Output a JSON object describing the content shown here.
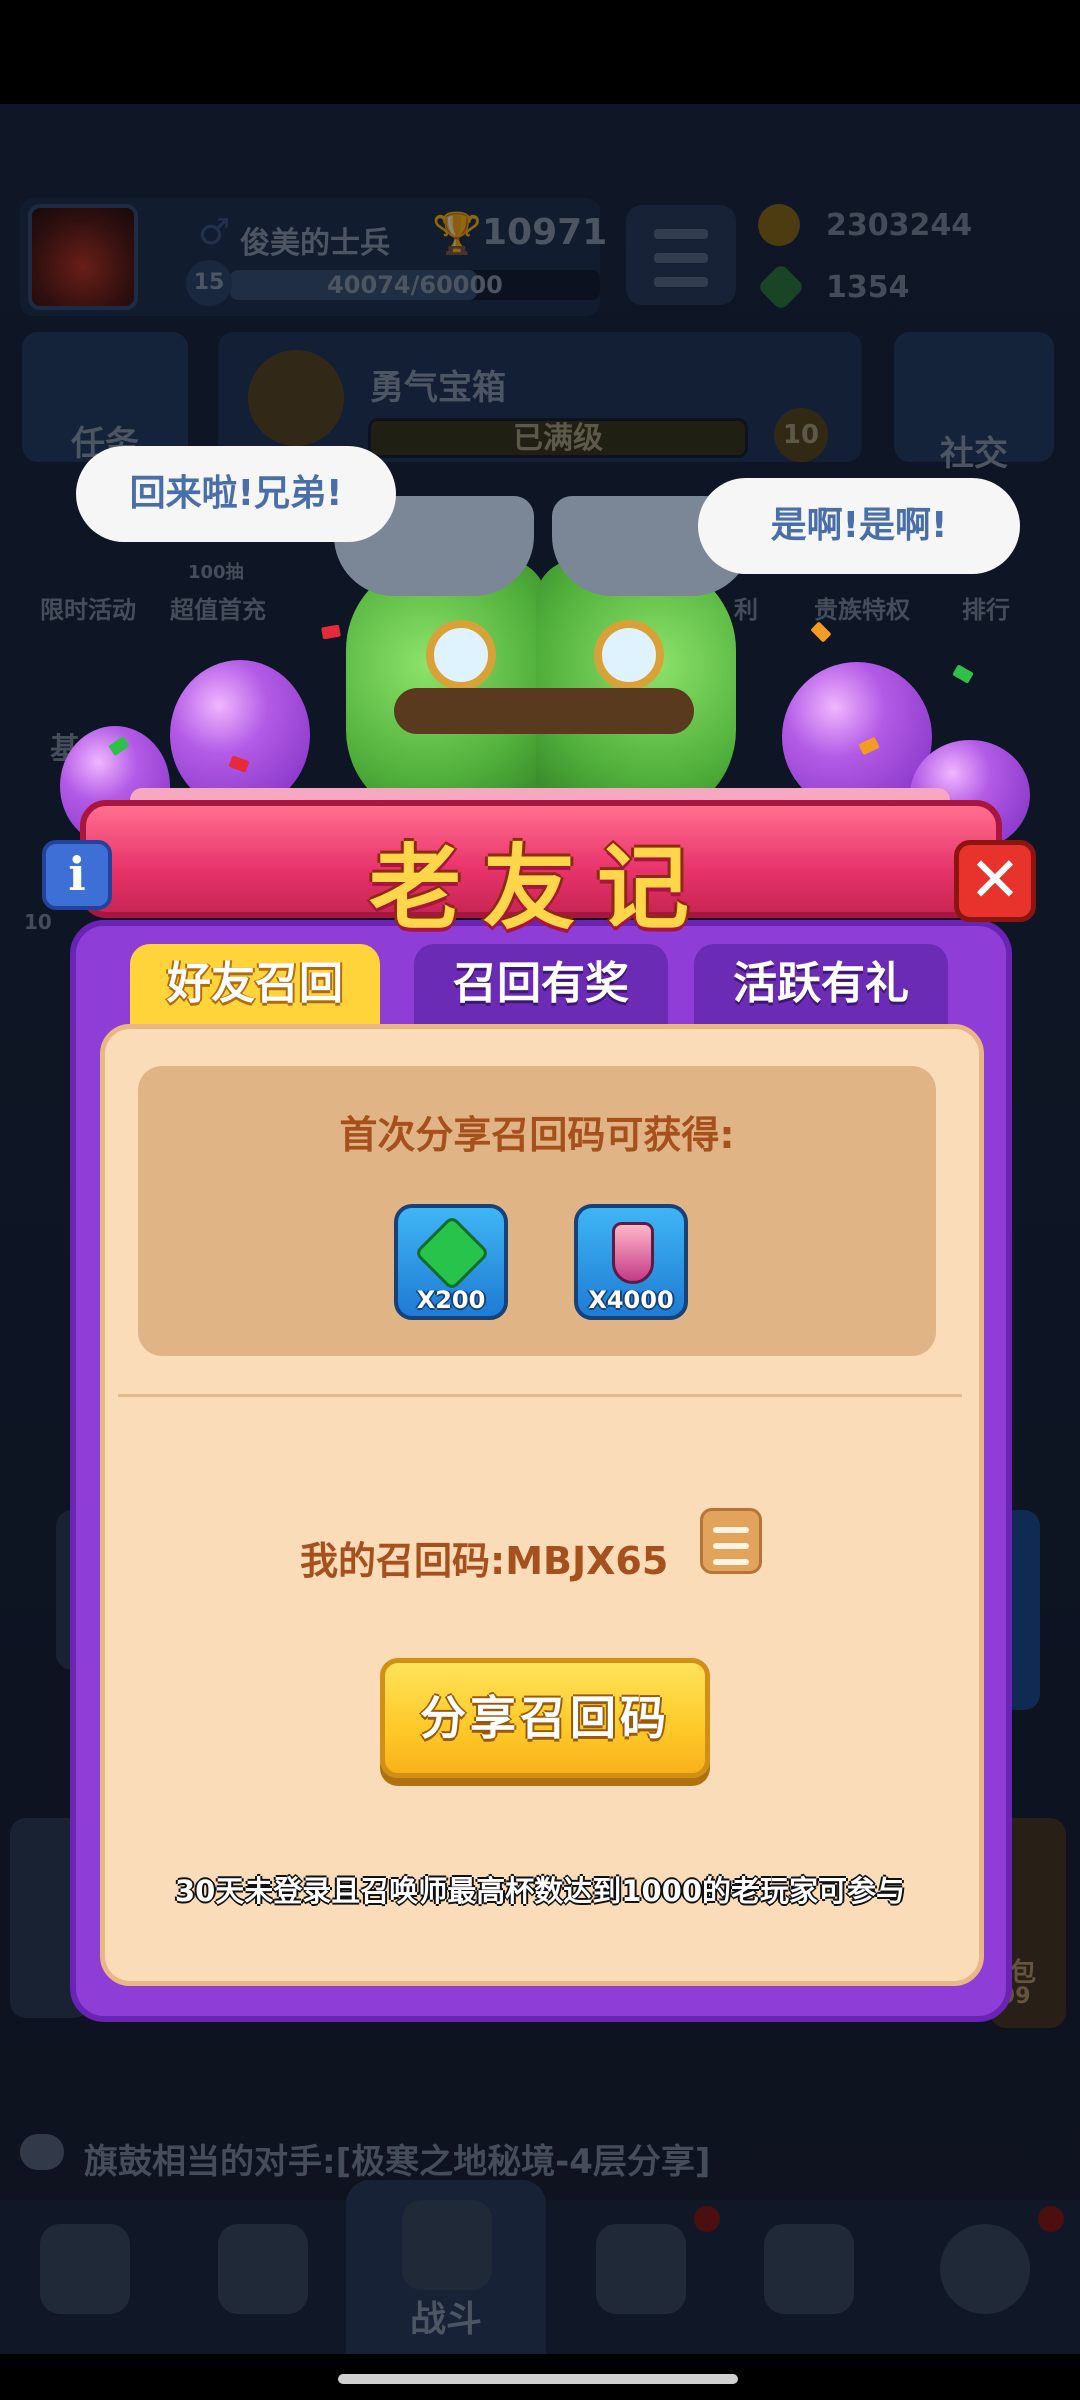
{
  "header": {
    "player_name": "俊美的士兵",
    "trophies": "10971",
    "level": "15",
    "xp": "40074/60000",
    "xp_progress": 0.668,
    "gold": "2303244",
    "gems": "1354"
  },
  "background": {
    "task_label": "任务",
    "chest_name": "勇气宝箱",
    "chest_status": "已满级",
    "chest_badge": "10",
    "social_label": "社交",
    "side_items": [
      "限时活动",
      "超值首充",
      "利",
      "贵族特权",
      "排行"
    ],
    "side_sub": [
      "100抽"
    ],
    "small_labels": [
      "基",
      "10",
      "包",
      "99"
    ]
  },
  "speech": {
    "left": "回来啦!兄弟!",
    "right": "是啊!是啊!"
  },
  "dialog": {
    "title": "老友记",
    "info_icon": "i",
    "close_icon": "✕",
    "tabs": [
      {
        "label": "好友召回",
        "active": true
      },
      {
        "label": "召回有奖",
        "active": false
      },
      {
        "label": "活跃有礼",
        "active": false
      }
    ],
    "reward_title": "首次分享召回码可获得:",
    "rewards": [
      {
        "icon": "gem-icon",
        "qty": "X200"
      },
      {
        "icon": "potion-icon",
        "qty": "X4000"
      }
    ],
    "code_label": "我的召回码:MBJX65",
    "share_button": "分享召回码",
    "note": "30天未登录且召唤师最高杯数达到1000的老玩家可参与"
  },
  "ticker": {
    "text": "旗鼓相当的对手:[极寒之地秘境-4层分享]"
  },
  "navbar": {
    "battle_label": "战斗"
  },
  "colors": {
    "dialog_frame": "#8e3ed6",
    "banner": "#e8336b",
    "title_text": "#ffd64a",
    "panel": "#fadcb8",
    "accent_text": "#a6511d",
    "share_button": "#ffc928"
  }
}
